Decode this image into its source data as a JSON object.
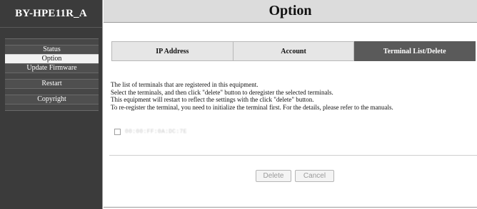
{
  "sidebar": {
    "brand": "BY-HPE11R_A",
    "items": [
      {
        "label": "Status",
        "active": false
      },
      {
        "label": "Option",
        "active": true
      },
      {
        "label": "Update Firmware",
        "active": false
      },
      {
        "label": "Restart",
        "active": false
      },
      {
        "label": "Copyright",
        "active": false
      }
    ]
  },
  "header": {
    "title": "Option"
  },
  "tabs": [
    {
      "label": "IP Address",
      "active": false
    },
    {
      "label": "Account",
      "active": false
    },
    {
      "label": "Terminal List/Delete",
      "active": true
    }
  ],
  "description": [
    "The list of terminals that are registered in this equipment.",
    "Select the terminals, and then click \"delete\" button to deregister the selected terminals.",
    "This equipment will restart to reflect the settings with the click \"delete\" button.",
    "To re-register the terminal, you need to initialize the terminal first. For the details, please refer to the manuals."
  ],
  "terminals": [
    {
      "label": "00:00:FF:0A:DC:7E",
      "checked": false
    }
  ],
  "buttons": {
    "delete": "Delete",
    "cancel": "Cancel"
  },
  "colors": {
    "sidebar_bg": "#3b3b3b",
    "active_tab": "#5a5a5a",
    "header_bg": "#dcdcdc"
  }
}
